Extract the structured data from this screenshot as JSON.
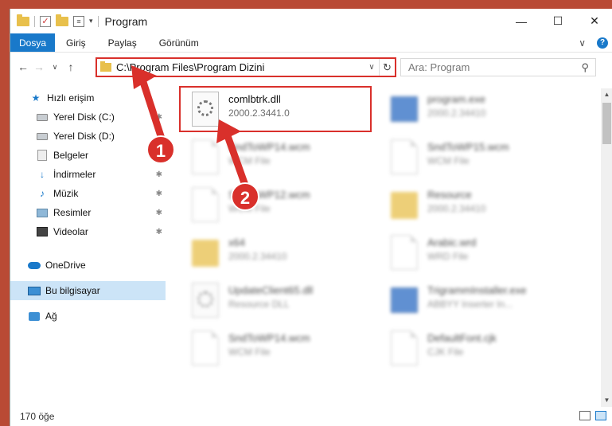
{
  "window": {
    "title": "Program"
  },
  "ribbon": {
    "tabs": [
      "Dosya",
      "Giriş",
      "Paylaş",
      "Görünüm"
    ]
  },
  "address": {
    "path": "C:\\Program Files\\Program Dizini"
  },
  "search": {
    "placeholder": "Ara: Program"
  },
  "sidebar": {
    "items": [
      {
        "label": "Hızlı erişim",
        "icon": "star-icon"
      },
      {
        "label": "Yerel Disk (C:)",
        "icon": "disk-icon"
      },
      {
        "label": "Yerel Disk (D:)",
        "icon": "disk-icon"
      },
      {
        "label": "Belgeler",
        "icon": "document-icon"
      },
      {
        "label": "İndirmeler",
        "icon": "download-icon"
      },
      {
        "label": "Müzik",
        "icon": "music-icon"
      },
      {
        "label": "Resimler",
        "icon": "pictures-icon"
      },
      {
        "label": "Videolar",
        "icon": "video-icon"
      },
      {
        "label": "OneDrive",
        "icon": "cloud-icon"
      },
      {
        "label": "Bu bilgisayar",
        "icon": "computer-icon"
      },
      {
        "label": "Ağ",
        "icon": "network-icon"
      }
    ]
  },
  "files": [
    {
      "name": "comlbtrk.dll",
      "sub": "2000.2.3441.0",
      "icon": "dll-icon"
    },
    {
      "name": "program.exe",
      "sub": "2000.2.34410",
      "icon": "exe-icon"
    },
    {
      "name": "SndToWP14.wcm",
      "sub": "WCM File",
      "icon": "file-icon"
    },
    {
      "name": "SndToWP15.wcm",
      "sub": "WCM File",
      "icon": "file-icon"
    },
    {
      "name": "SndToWP12.wcm",
      "sub": "WCM File",
      "icon": "file-icon"
    },
    {
      "name": "Resource",
      "sub": "2000.2.34410",
      "icon": "folder-icon"
    },
    {
      "name": "x64",
      "sub": "2000.2.34410",
      "icon": "folder-icon"
    },
    {
      "name": "Arabic.wrd",
      "sub": "WRD File",
      "icon": "file-icon"
    },
    {
      "name": "UpdateClient65.dll",
      "sub": "Resource DLL",
      "icon": "dll-icon"
    },
    {
      "name": "TrigrammInstaller.exe",
      "sub": "ABBYY Inserter In...",
      "icon": "exe-icon"
    },
    {
      "name": "SndToWP14.wcm",
      "sub": "WCM File",
      "icon": "file-icon"
    },
    {
      "name": "DefaultFont.cjk",
      "sub": "CJK File",
      "icon": "file-icon"
    }
  ],
  "status": {
    "count": "170 öğe"
  },
  "annotations": {
    "step1": "1",
    "step2": "2"
  },
  "colors": {
    "accent": "#1979ca",
    "highlight": "#d9302b"
  }
}
